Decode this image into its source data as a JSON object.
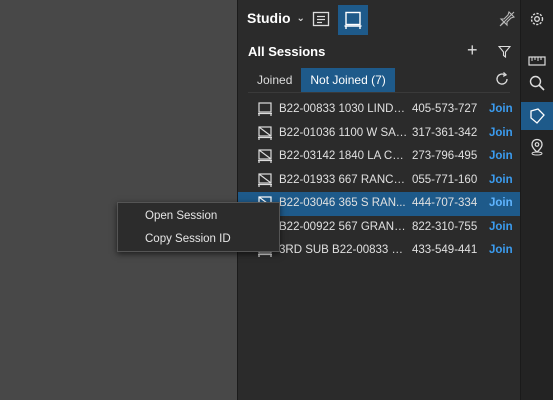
{
  "header": {
    "studio_label": "Studio"
  },
  "sessions": {
    "title": "All Sessions",
    "tabs": [
      {
        "label": "Joined",
        "active": false
      },
      {
        "label": "Not Joined (7)",
        "active": true
      }
    ],
    "rows": [
      {
        "name": "B22-00833 1030 LINDA...",
        "phone": "405-573-727",
        "action": "Join",
        "selected": false
      },
      {
        "name": "B22-01036  1100 W SAN...",
        "phone": "317-361-342",
        "action": "Join",
        "selected": false
      },
      {
        "name": "B22-03142  1840 LA CO...",
        "phone": "273-796-495",
        "action": "Join",
        "selected": false
      },
      {
        "name": "B22-01933 667 RANCH...",
        "phone": "055-771-160",
        "action": "Join",
        "selected": false
      },
      {
        "name": "B22-03046  365 S RAN...",
        "phone": "444-707-334",
        "action": "Join",
        "selected": true
      },
      {
        "name": "B22-00922 567 GRAND...",
        "phone": "822-310-755",
        "action": "Join",
        "selected": false
      },
      {
        "name": "3RD SUB B22-00833 10...",
        "phone": "433-549-441",
        "action": "Join",
        "selected": false
      }
    ]
  },
  "context_menu": {
    "items": [
      "Open Session",
      "Copy Session ID"
    ]
  },
  "colors": {
    "accent": "#1e5a8a",
    "join": "#3b9cf0",
    "panel": "#2b2b2b",
    "canvas": "#484848"
  },
  "icons": {
    "header": [
      "notes-icon",
      "sessions-icon",
      "unpin-icon"
    ],
    "actions": [
      "plus-icon",
      "filter-icon",
      "refresh-icon"
    ],
    "rail": [
      "gear-icon",
      "ruler-icon",
      "search-icon",
      "tag-icon",
      "location-pin-icon"
    ]
  }
}
